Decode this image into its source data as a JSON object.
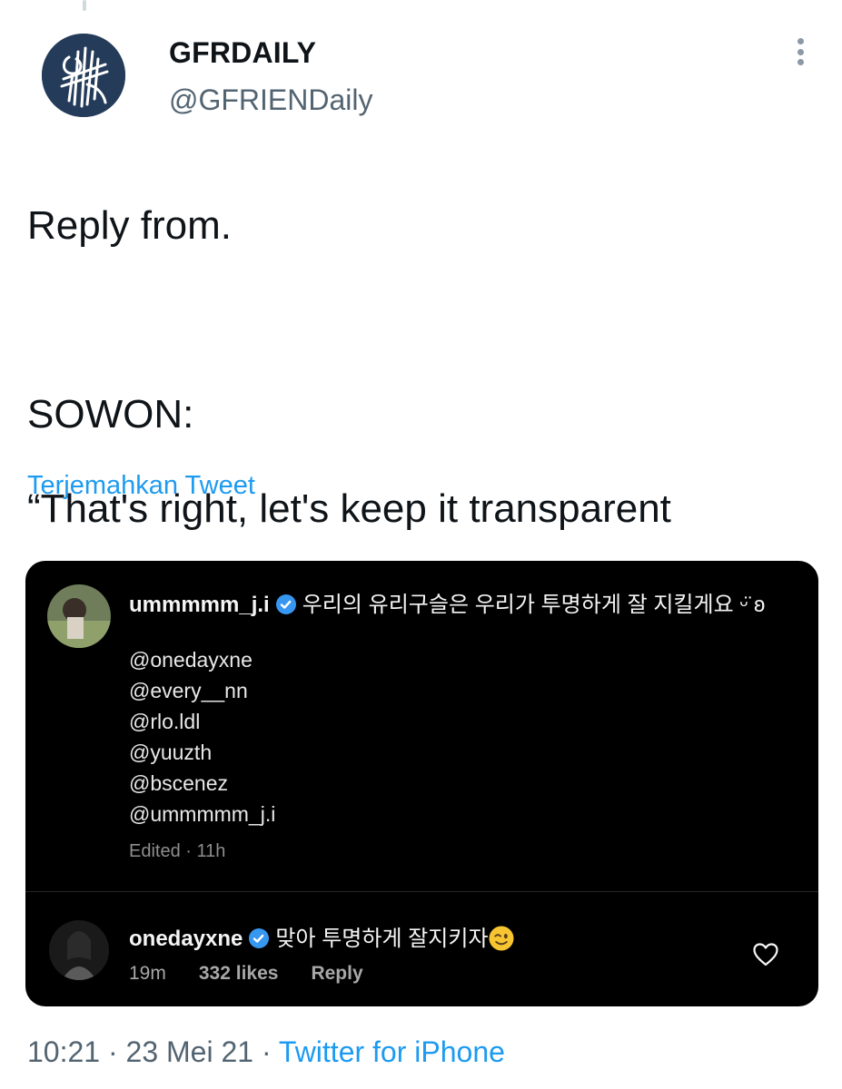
{
  "author": {
    "display_name": "GFRDAILY",
    "handle": "@GFRIENDaily",
    "avatar_icon": "gfr-logo-avatar"
  },
  "tweet": {
    "line1": "Reply from.",
    "line2": "SOWON:",
    "line3": "“That's right, let's keep it transparent",
    "closing_quote": "”",
    "emoji": "winking-face"
  },
  "translate_label": "Terjemahkan Tweet",
  "instagram": {
    "comment": {
      "username": "ummmmm_j.i",
      "text": "우리의 유리구슬은 우리가 투명하게 잘 지킬게요 ᵕ̈ ʚ",
      "mentions": [
        "@onedayxne",
        "@every__nn",
        "@rlo.ldl",
        "@yuuzth",
        "@bscenez",
        "@ummmmm_j.i"
      ],
      "meta": "Edited · 11h"
    },
    "reply": {
      "username": "onedayxne",
      "text": "맞아 투명하게 잘지키자",
      "time": "19m",
      "likes": "332 likes",
      "reply_label": "Reply"
    },
    "verified_color": "#3797f0"
  },
  "footer": {
    "time_date": "10:21 · 23 Mei 21 · ",
    "source": "Twitter for iPhone"
  },
  "colors": {
    "link": "#1d9bf0",
    "text": "#0f1419",
    "secondary": "#536471"
  }
}
